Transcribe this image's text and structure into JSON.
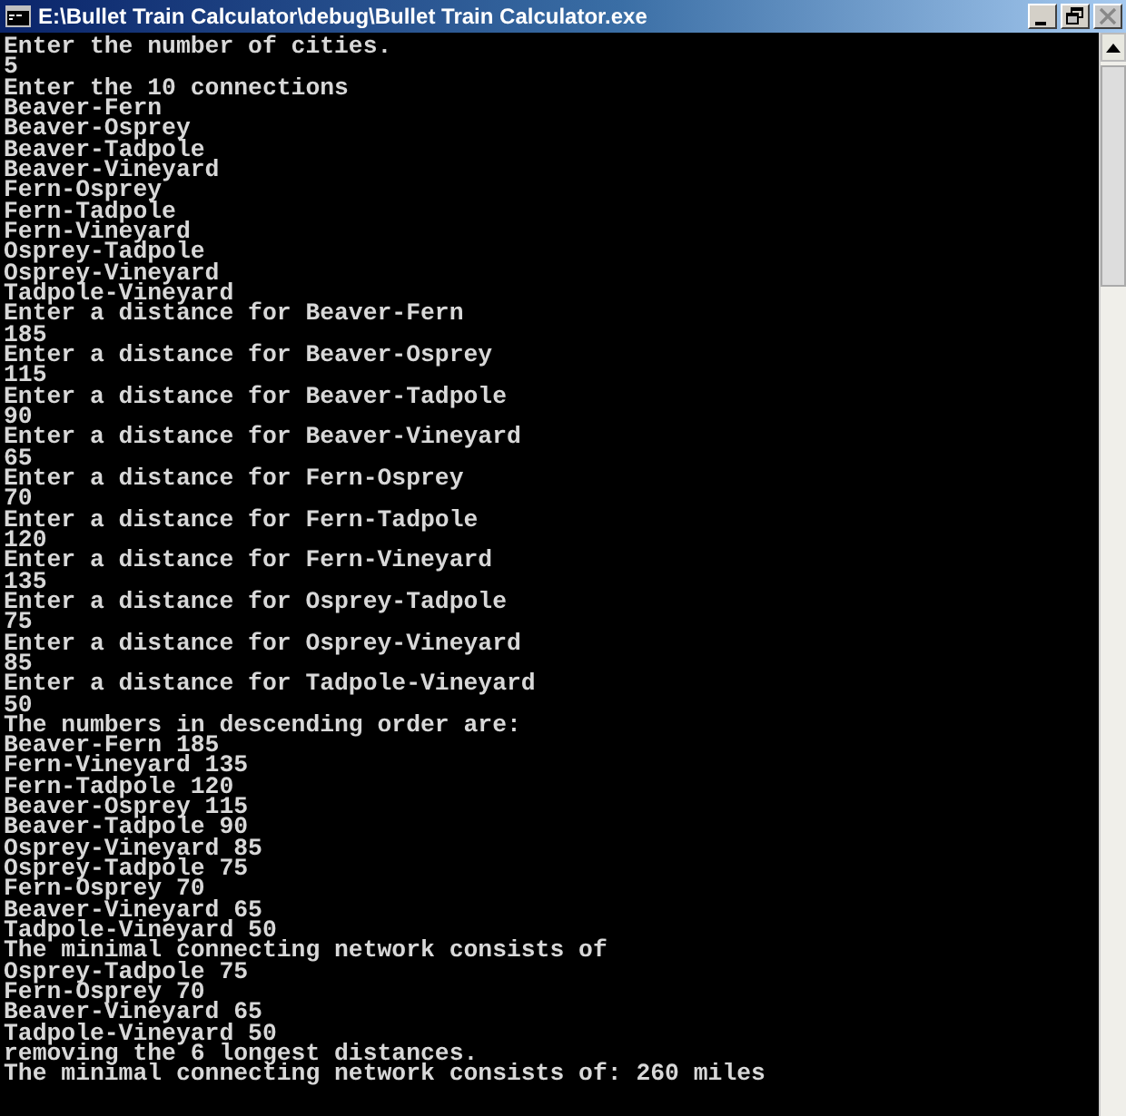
{
  "window": {
    "title": "E:\\Bullet Train Calculator\\debug\\Bullet Train Calculator.exe",
    "buttons": [
      {
        "kind": "minimize",
        "disabled": false
      },
      {
        "kind": "restore",
        "disabled": false
      },
      {
        "kind": "close",
        "disabled": true
      }
    ]
  },
  "console": {
    "lines": [
      "Enter the number of cities.",
      "5",
      "Enter the 10 connections",
      "Beaver-Fern",
      "Beaver-Osprey",
      "Beaver-Tadpole",
      "Beaver-Vineyard",
      "Fern-Osprey",
      "Fern-Tadpole",
      "Fern-Vineyard",
      "Osprey-Tadpole",
      "Osprey-Vineyard",
      "Tadpole-Vineyard",
      "Enter a distance for Beaver-Fern",
      "185",
      "Enter a distance for Beaver-Osprey",
      "115",
      "Enter a distance for Beaver-Tadpole",
      "90",
      "Enter a distance for Beaver-Vineyard",
      "65",
      "Enter a distance for Fern-Osprey",
      "70",
      "Enter a distance for Fern-Tadpole",
      "120",
      "Enter a distance for Fern-Vineyard",
      "135",
      "Enter a distance for Osprey-Tadpole",
      "75",
      "Enter a distance for Osprey-Vineyard",
      "85",
      "Enter a distance for Tadpole-Vineyard",
      "50",
      "The numbers in descending order are:",
      "Beaver-Fern 185",
      "Fern-Vineyard 135",
      "Fern-Tadpole 120",
      "Beaver-Osprey 115",
      "Beaver-Tadpole 90",
      "Osprey-Vineyard 85",
      "Osprey-Tadpole 75",
      "Fern-Osprey 70",
      "Beaver-Vineyard 65",
      "Tadpole-Vineyard 50",
      "The minimal connecting network consists of",
      "Osprey-Tadpole 75",
      "Fern-Osprey 70",
      "Beaver-Vineyard 65",
      "Tadpole-Vineyard 50",
      "removing the 6 longest distances.",
      "The minimal connecting network consists of: 260 miles"
    ]
  }
}
